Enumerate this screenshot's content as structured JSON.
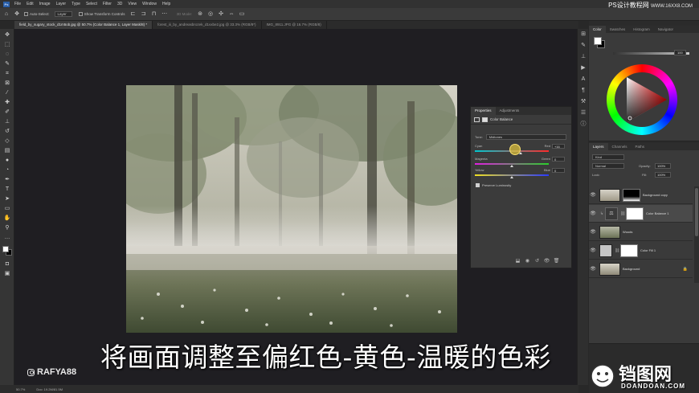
{
  "app": {
    "menu": [
      "File",
      "Edit",
      "Image",
      "Layer",
      "Type",
      "Select",
      "Filter",
      "3D",
      "View",
      "Window",
      "Help"
    ],
    "watermark_top": "PS设计教程网",
    "watermark_top_url": "WWW.16XX8.COM"
  },
  "options": {
    "auto_select": "Auto-Select:",
    "auto_select_target": "Layer",
    "show_transform": "Show Transform Controls",
    "mode_3d": "3D Mode:"
  },
  "tabs": [
    {
      "label": "field_by_sugary_stock_d1m5ob.jpg @ 50.7% (Color Balance 1, Layer Mask/8) *",
      "active": true
    },
    {
      "label": "forest_iii_by_andreasbrozek_d1vxbe2.jpg @ 33.3% (RGB/8*)",
      "active": false
    },
    {
      "label": "IMG_8911.JPG @ 16.7% (RGB/8)",
      "active": false
    }
  ],
  "caption": "将画面调整至偏红色-黄色-温暖的色彩",
  "channel": "RAFYA88",
  "status": {
    "zoom": "50.7%",
    "doc": "Doc: 19.2M/81.5M"
  },
  "properties": {
    "tabs": [
      "Properties",
      "Adjustments"
    ],
    "title": "Color Balance",
    "tone_label": "Tone:",
    "tone_value": "Midtones",
    "sliders": [
      {
        "left": "Cyan",
        "right": "Red",
        "value": "+16",
        "pos": 0.62
      },
      {
        "left": "Magenta",
        "right": "Green",
        "value": "0",
        "pos": 0.5
      },
      {
        "left": "Yellow",
        "right": "Blue",
        "value": "0",
        "pos": 0.5
      }
    ],
    "preserve": "Preserve Luminosity"
  },
  "color_panel": {
    "tabs": [
      "Color",
      "Swatches",
      "Histogram",
      "Navigator"
    ],
    "hue_value": "100"
  },
  "layers_panel": {
    "tabs": [
      "Layers",
      "Channels",
      "Paths"
    ],
    "filter": "Kind",
    "blend_mode": "Normal",
    "opacity_label": "Opacity:",
    "opacity_value": "100%",
    "lock_label": "Lock:",
    "fill_label": "Fill:",
    "fill_value": "100%",
    "layers": [
      {
        "name": "Background copy",
        "kind": "image-mask"
      },
      {
        "name": "Color Balance 1",
        "kind": "adjustment",
        "selected": true
      },
      {
        "name": "Woods",
        "kind": "image"
      },
      {
        "name": "Color Fill 1",
        "kind": "fill"
      },
      {
        "name": "Background",
        "kind": "background"
      }
    ]
  },
  "brand": {
    "cn": "铛图网",
    "en": "DOANDOAN.COM"
  },
  "colors": {
    "accent_cursor": "#e0c040",
    "canvas_bg": "#1f1e22"
  }
}
